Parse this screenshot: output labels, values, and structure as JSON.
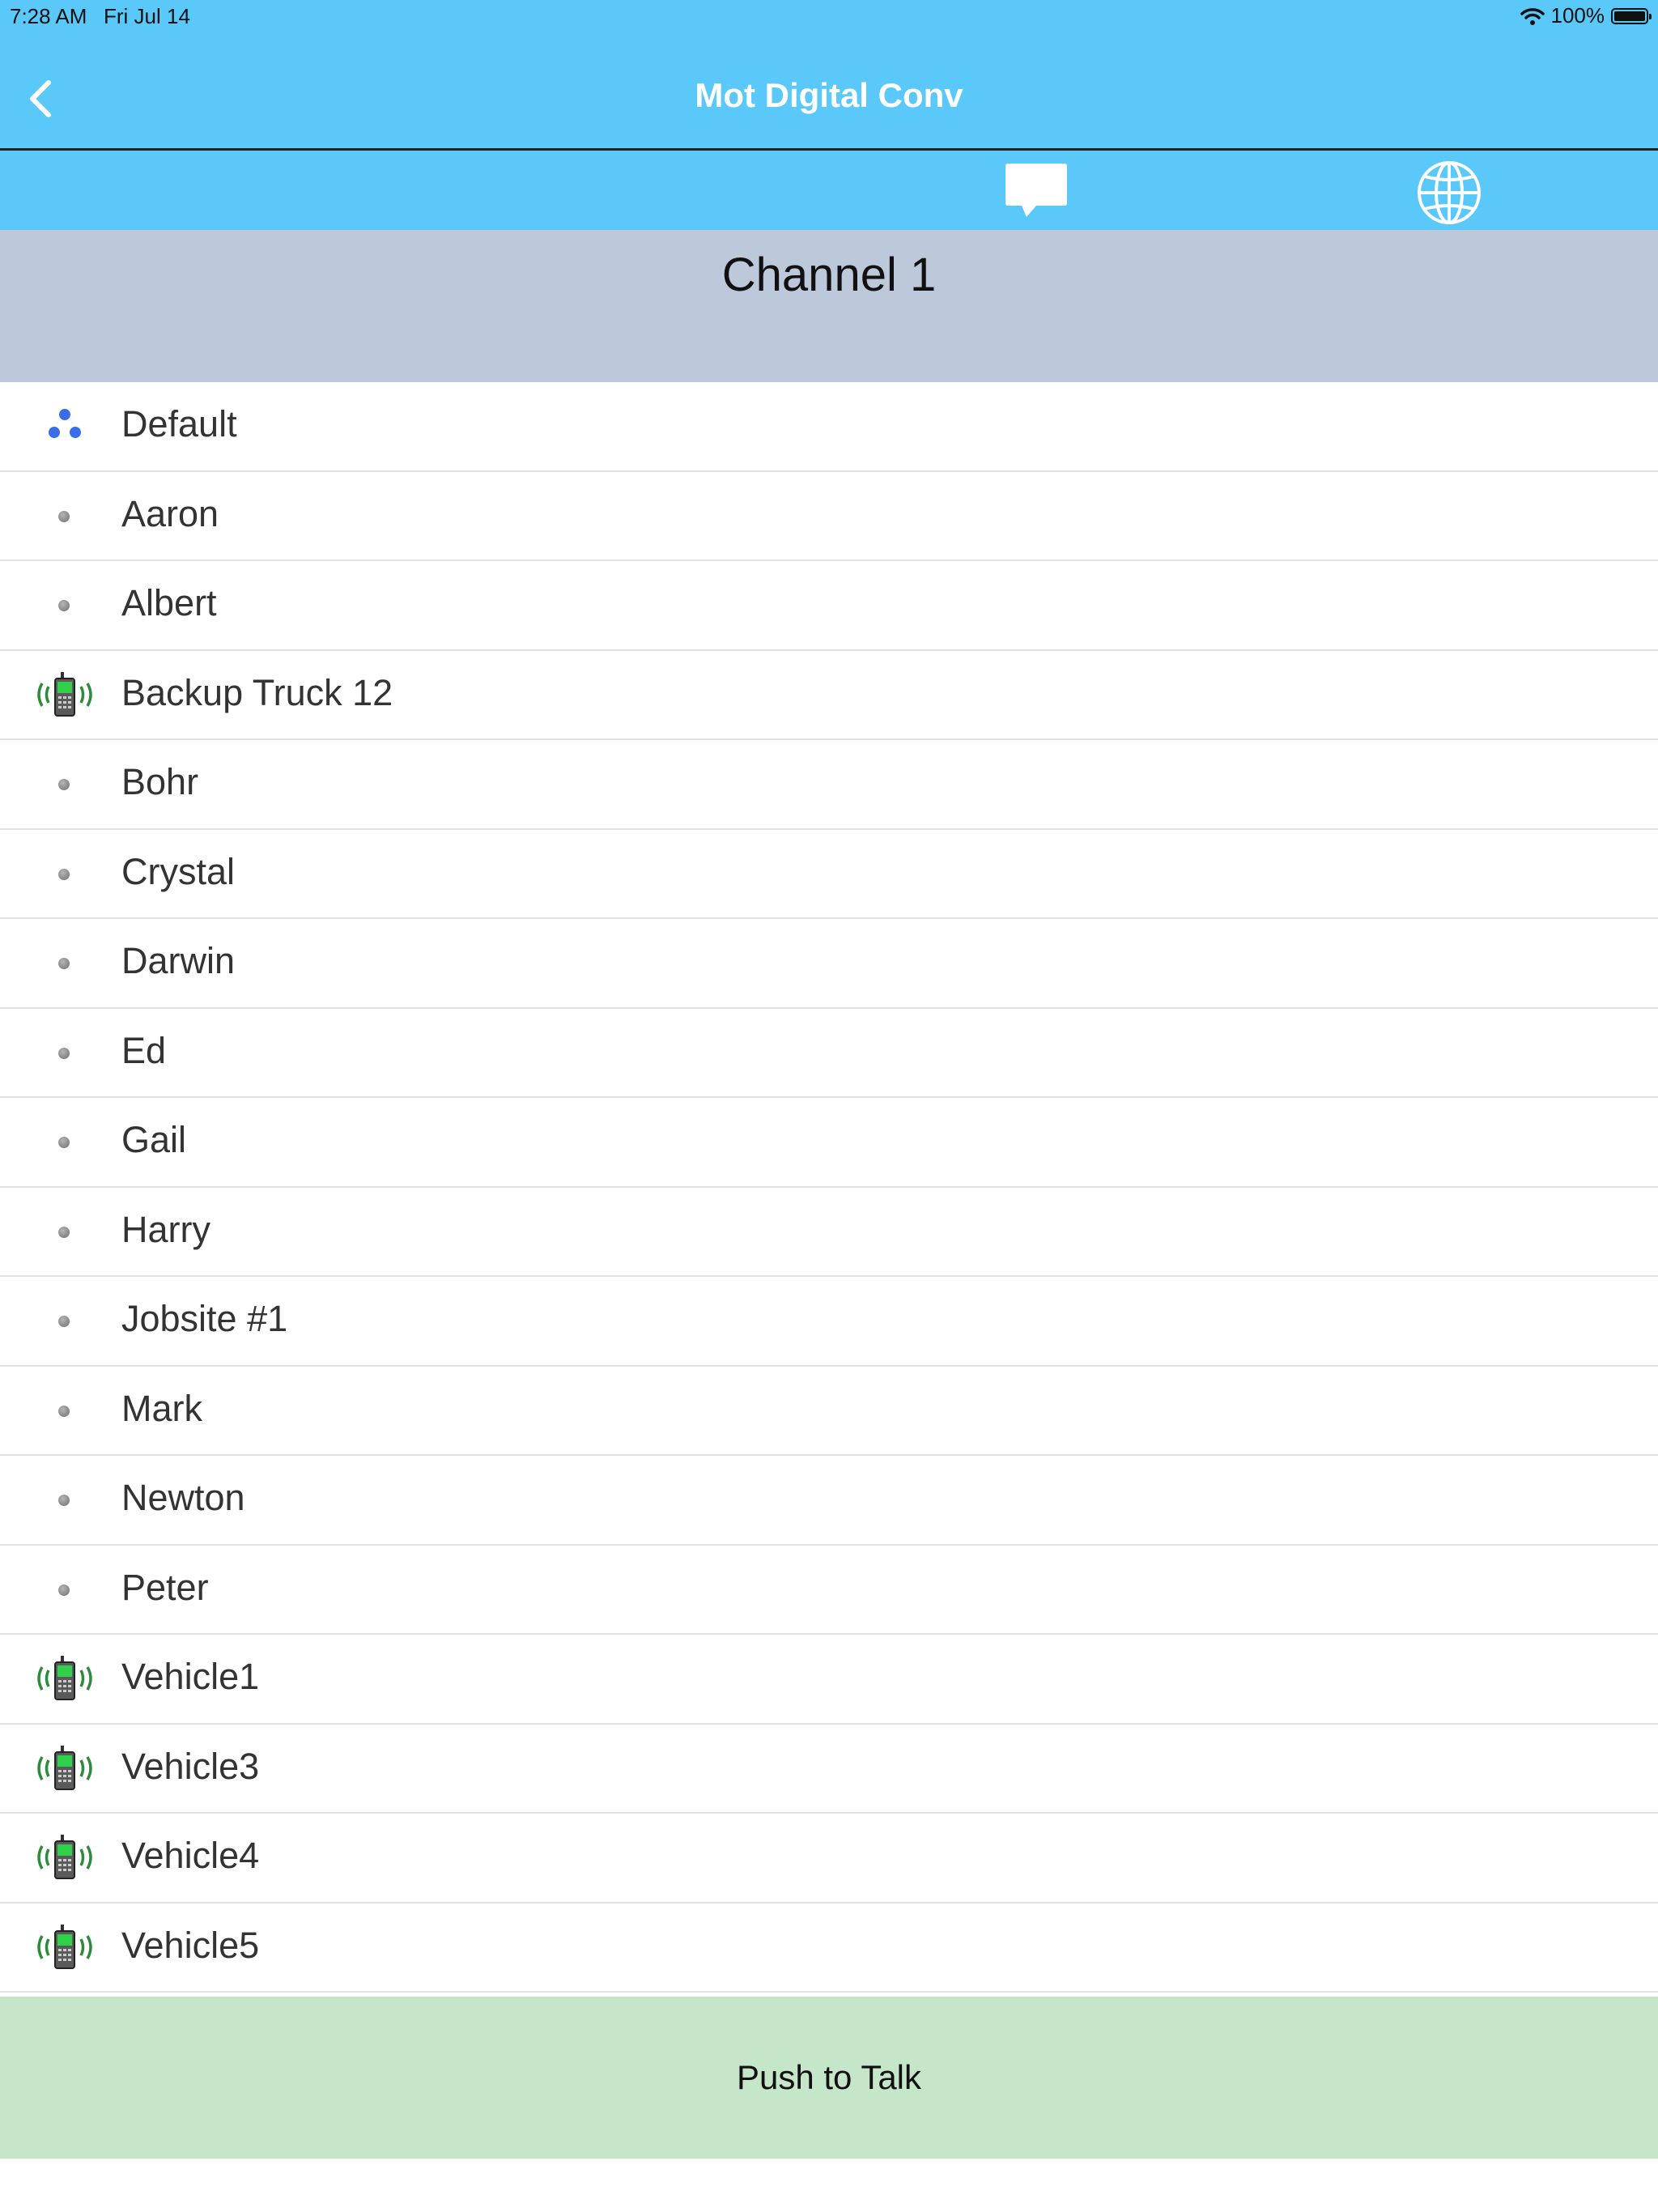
{
  "status_bar": {
    "time": "7:28 AM",
    "date": "Fri Jul 14",
    "battery_text": "100%"
  },
  "nav": {
    "title": "Mot Digital Conv",
    "back_icon": "chevron-left-icon"
  },
  "toolbar": {
    "message_icon": "chat-bubble-icon",
    "globe_icon": "globe-icon"
  },
  "channel": {
    "title": "Channel 1"
  },
  "list": {
    "items": [
      {
        "label": "Default",
        "icon": "group-icon"
      },
      {
        "label": "Aaron",
        "icon": "offline-dot-icon"
      },
      {
        "label": "Albert",
        "icon": "offline-dot-icon"
      },
      {
        "label": "Backup Truck 12",
        "icon": "radio-icon"
      },
      {
        "label": "Bohr",
        "icon": "offline-dot-icon"
      },
      {
        "label": "Crystal",
        "icon": "offline-dot-icon"
      },
      {
        "label": "Darwin",
        "icon": "offline-dot-icon"
      },
      {
        "label": "Ed",
        "icon": "offline-dot-icon"
      },
      {
        "label": "Gail",
        "icon": "offline-dot-icon"
      },
      {
        "label": "Harry",
        "icon": "offline-dot-icon"
      },
      {
        "label": "Jobsite #1",
        "icon": "offline-dot-icon"
      },
      {
        "label": "Mark",
        "icon": "offline-dot-icon"
      },
      {
        "label": "Newton",
        "icon": "offline-dot-icon"
      },
      {
        "label": "Peter",
        "icon": "offline-dot-icon"
      },
      {
        "label": "Vehicle1",
        "icon": "radio-icon"
      },
      {
        "label": "Vehicle3",
        "icon": "radio-icon"
      },
      {
        "label": "Vehicle4",
        "icon": "radio-icon"
      },
      {
        "label": "Vehicle5",
        "icon": "radio-icon"
      }
    ]
  },
  "push_to_talk": {
    "label": "Push to Talk"
  },
  "colors": {
    "nav_background": "#5bc8fa",
    "channel_header_background": "#bdc8da",
    "ptt_background": "#c6e6c9",
    "group_dot": "#3a6ee8",
    "radio_green": "#2e8b3a"
  }
}
